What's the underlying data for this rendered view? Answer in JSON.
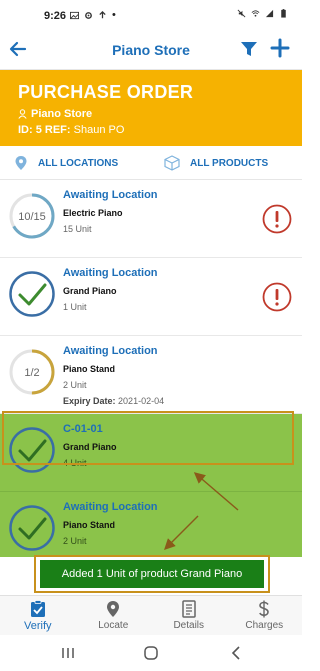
{
  "status_bar": {
    "time": "9:26",
    "dot": "•"
  },
  "app_bar": {
    "title": "Piano Store"
  },
  "purchase_order": {
    "heading": "PURCHASE ORDER",
    "store": "Piano Store",
    "id_label": "ID: 5",
    "ref_label": "REF:",
    "ref_value": "Shaun PO"
  },
  "filters": {
    "locations": "ALL LOCATIONS",
    "products": "ALL PRODUCTS"
  },
  "items": [
    {
      "status": "Awaiting Location",
      "name": "Electric Piano",
      "qty": "15 Unit",
      "progress_text": "10/15",
      "progress": 0.6667,
      "alert": true
    },
    {
      "status": "Awaiting Location",
      "name": "Grand Piano",
      "qty": "1 Unit",
      "complete": true,
      "alert": true
    },
    {
      "status": "Awaiting Location",
      "name": "Piano Stand",
      "qty": "2 Unit",
      "progress_text": "1/2",
      "progress": 0.5,
      "expiry_label": "Expiry Date:",
      "expiry_value": "2021-02-04"
    },
    {
      "status": "C-01-01",
      "name": "Grand Piano",
      "qty": "4 Unit",
      "complete": true
    },
    {
      "status": "Awaiting Location",
      "name": "Piano Stand",
      "qty": "2 Unit",
      "complete": true
    }
  ],
  "snackbar": {
    "message": "Added 1 Unit of product Grand Piano"
  },
  "bottom_nav": [
    {
      "label": "Verify",
      "icon": "verify-clipboard-icon",
      "active": true
    },
    {
      "label": "Locate",
      "icon": "location-pin-icon"
    },
    {
      "label": "Details",
      "icon": "document-icon"
    },
    {
      "label": "Charges",
      "icon": "dollar-icon"
    }
  ],
  "colors": {
    "accent": "#1e6fb8",
    "header": "#f6b201",
    "highlight_green": "#8bc34a",
    "snackbar": "#1a7f17",
    "alert": "#c0392b",
    "annotation": "#c8911c"
  }
}
